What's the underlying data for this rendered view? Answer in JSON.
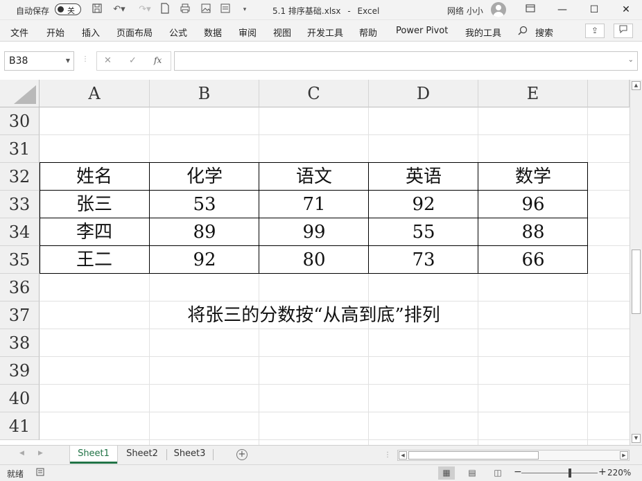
{
  "titlebar": {
    "autosave_label": "自动保存",
    "autosave_state": "关",
    "file_title": "5.1 排序基础.xlsx",
    "separator": "-",
    "app_name": "Excel",
    "user_name": "网络 小小"
  },
  "menu": [
    "文件",
    "开始",
    "插入",
    "页面布局",
    "公式",
    "数据",
    "审阅",
    "视图",
    "开发工具",
    "帮助",
    "Power Pivot",
    "我的工具"
  ],
  "search_label": "搜索",
  "namebox": {
    "value": "B38"
  },
  "formula": {
    "fx": "fx",
    "cancel": "✕",
    "enter": "✓",
    "value": ""
  },
  "columns": [
    "A",
    "B",
    "C",
    "D",
    "E"
  ],
  "rows": [
    "30",
    "31",
    "32",
    "33",
    "34",
    "35",
    "36",
    "37",
    "38",
    "39",
    "40",
    "41"
  ],
  "table": {
    "header": [
      "姓名",
      "化学",
      "语文",
      "英语",
      "数学"
    ],
    "rows": [
      [
        "张三",
        "53",
        "71",
        "92",
        "96"
      ],
      [
        "李四",
        "89",
        "99",
        "55",
        "88"
      ],
      [
        "王二",
        "92",
        "80",
        "73",
        "66"
      ]
    ]
  },
  "note": "将张三的分数按“从高到底”排列",
  "sheets": [
    "Sheet1",
    "Sheet2",
    "Sheet3"
  ],
  "active_sheet": "Sheet1",
  "status": {
    "ready": "就绪",
    "zoom": "220%"
  },
  "colors": {
    "accent": "#217346"
  }
}
